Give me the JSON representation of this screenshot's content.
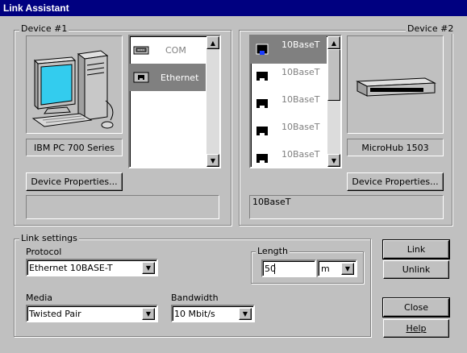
{
  "window": {
    "title": "Link Assistant"
  },
  "device1": {
    "group_label": "Device #1",
    "name": "IBM PC 700 Series",
    "connections": [
      {
        "label": "COM",
        "icon": "serial-port-icon",
        "selected": false
      },
      {
        "label": "Ethernet",
        "icon": "ethernet-port-icon",
        "selected": true
      }
    ],
    "properties_button": "Device Properties...",
    "status_text": ""
  },
  "device2": {
    "group_label": "Device #2",
    "name": "MicroHub 1503",
    "ports": [
      {
        "label": "10BaseT",
        "selected": true
      },
      {
        "label": "10BaseT",
        "selected": false
      },
      {
        "label": "10BaseT",
        "selected": false
      },
      {
        "label": "10BaseT",
        "selected": false
      },
      {
        "label": "10BaseT",
        "selected": false
      }
    ],
    "properties_button": "Device Properties...",
    "status_text": "10BaseT"
  },
  "link_settings": {
    "group_label": "Link settings",
    "protocol_label": "Protocol",
    "protocol_value": "Ethernet 10BASE-T",
    "media_label": "Media",
    "media_value": "Twisted Pair",
    "bandwidth_label": "Bandwidth",
    "bandwidth_value": "10 Mbit/s",
    "length_label": "Length",
    "length_value": "50",
    "length_unit": "m"
  },
  "buttons": {
    "link": "Link",
    "unlink": "Unlink",
    "close": "Close",
    "help": "Help"
  },
  "colors": {
    "title_bar": "#000080",
    "face": "#c0c0c0",
    "selection": "#808080",
    "monitor_screen": "#33ccee"
  }
}
